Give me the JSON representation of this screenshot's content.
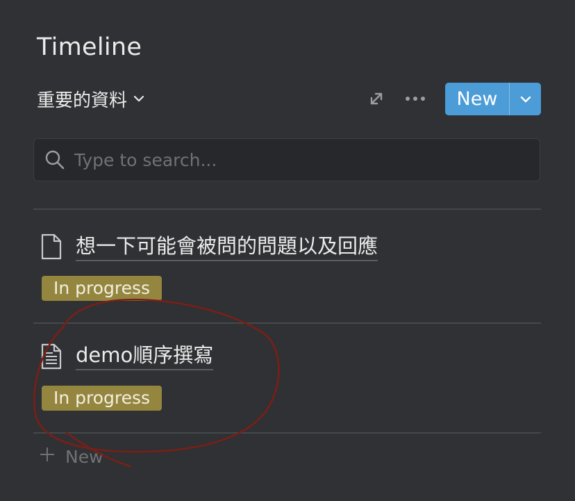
{
  "header": {
    "title": "Timeline",
    "view_name": "重要的資料",
    "new_button_label": "New"
  },
  "search": {
    "placeholder": "Type to search..."
  },
  "items": [
    {
      "title": "想一下可能會被問的問題以及回應",
      "status": "In progress",
      "icon": "page-blank-icon"
    },
    {
      "title": "demo順序撰寫",
      "status": "In progress",
      "icon": "page-text-icon"
    }
  ],
  "footer": {
    "add_label": "New"
  },
  "colors": {
    "background": "#2f3134",
    "accent": "#4b9cd7",
    "status_in_progress": "#95863f",
    "annotation": "#7a1f16"
  }
}
